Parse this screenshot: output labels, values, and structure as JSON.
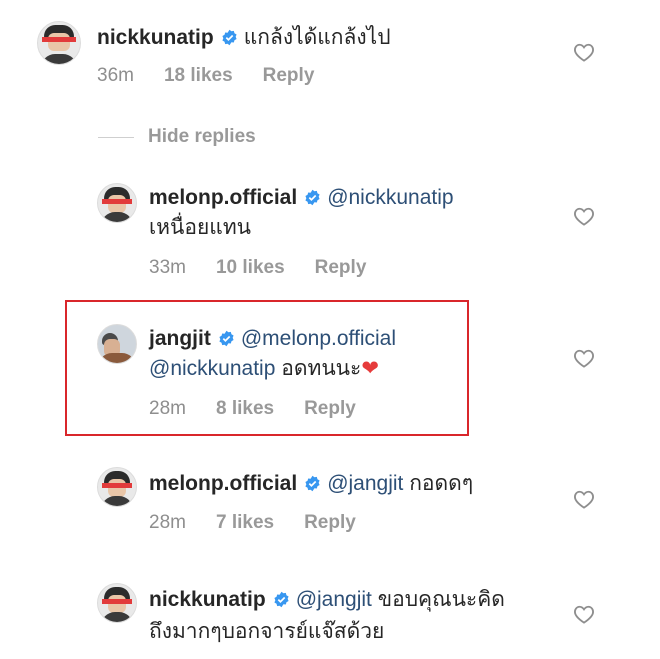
{
  "comments": [
    {
      "username": "nickkunatip",
      "mention": "",
      "text": "แกล้งได้แกล้งไป",
      "time": "36m",
      "likes": "18 likes",
      "reply": "Reply"
    },
    {
      "username": "melonp.official",
      "mention": "@nickkunatip",
      "text": "เหนื่อยแทน",
      "time": "33m",
      "likes": "10 likes",
      "reply": "Reply"
    },
    {
      "username": "jangjit",
      "mention": "@melonp.official",
      "mention2": "@nickkunatip",
      "text": "อดทนนะ",
      "emoji": "❤",
      "time": "28m",
      "likes": "8 likes",
      "reply": "Reply"
    },
    {
      "username": "melonp.official",
      "mention": "@jangjit",
      "text": "กอดดๆ",
      "time": "28m",
      "likes": "7 likes",
      "reply": "Reply"
    },
    {
      "username": "nickkunatip",
      "mention": "@jangjit",
      "text": "ขอบคุณนะคิด",
      "text2": "ถึงมากๆบอกจารย์แจ๊สด้วย",
      "time": "",
      "likes": "",
      "reply": ""
    }
  ],
  "hide_replies_label": "Hide replies",
  "icons": {
    "verified": "verified-badge-icon",
    "like": "heart-outline-icon"
  },
  "colors": {
    "verified": "#3897f0",
    "highlight_border": "#d9262b",
    "meta_text": "#999999",
    "mention": "#2d4f76"
  }
}
